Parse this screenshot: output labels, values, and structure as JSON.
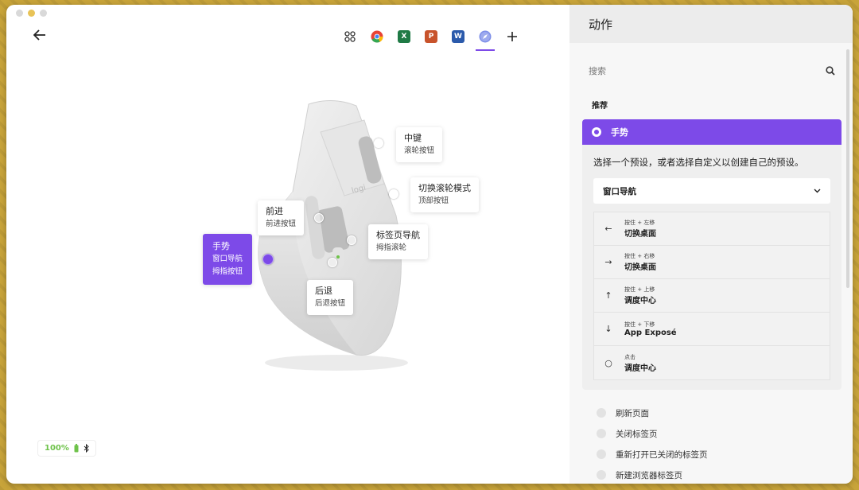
{
  "window": {
    "traffic_lights": [
      "close",
      "minimize",
      "zoom"
    ]
  },
  "app_tabs": [
    {
      "name": "all-apps",
      "icon": "grid-icon"
    },
    {
      "name": "chrome",
      "icon": "chrome-icon"
    },
    {
      "name": "excel",
      "icon": "excel-icon",
      "glyph": "X"
    },
    {
      "name": "powerpoint",
      "icon": "powerpoint-icon",
      "glyph": "P"
    },
    {
      "name": "word",
      "icon": "word-icon",
      "glyph": "W"
    },
    {
      "name": "safari",
      "icon": "safari-icon"
    },
    {
      "name": "add",
      "icon": "plus-icon"
    }
  ],
  "callouts": {
    "middle": {
      "title": "中键",
      "sub": "滚轮按钮"
    },
    "scroll_mode": {
      "title": "切换滚轮模式",
      "sub": "顶部按钮"
    },
    "forward": {
      "title": "前进",
      "sub": "前进按钮"
    },
    "tab_nav": {
      "title": "标签页导航",
      "sub": "拇指滚轮"
    },
    "gesture": {
      "title": "手势",
      "line2": "窗口导航",
      "sub": "拇指按钮"
    },
    "back": {
      "title": "后退",
      "sub": "后退按钮"
    }
  },
  "battery": {
    "percent": "100%"
  },
  "panel": {
    "title": "动作",
    "search_placeholder": "搜索",
    "section_title": "推荐",
    "gesture_card": {
      "label": "手势",
      "description": "选择一个预设，或者选择自定义以创建自己的预设。",
      "preset": "窗口导航",
      "items": [
        {
          "arrow": "←",
          "hint": "按住 + 左移",
          "action": "切换桌面"
        },
        {
          "arrow": "→",
          "hint": "按住 + 右移",
          "action": "切换桌面"
        },
        {
          "arrow": "↑",
          "hint": "按住 + 上移",
          "action": "调度中心"
        },
        {
          "arrow": "↓",
          "hint": "按住 + 下移",
          "action": "App Exposé"
        },
        {
          "arrow": "○",
          "hint": "点击",
          "action": "调度中心"
        }
      ]
    },
    "other_actions": [
      "刷新页面",
      "关闭标签页",
      "重新打开已关闭的标签页",
      "新建浏览器标签页"
    ]
  },
  "colors": {
    "accent": "#7d4ae8",
    "battery": "#6ec24a",
    "panel_bg": "#f7f7f7"
  }
}
